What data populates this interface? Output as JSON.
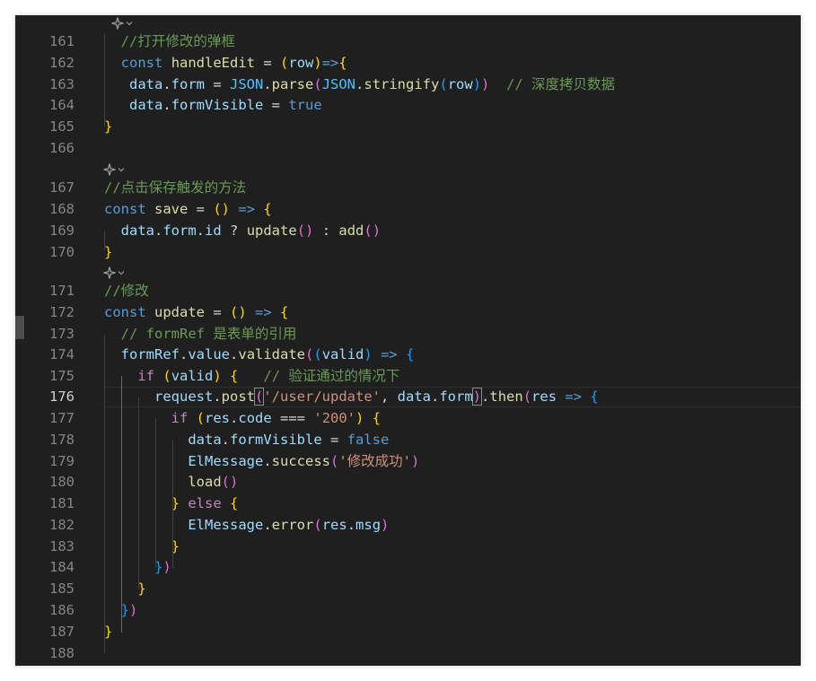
{
  "editor": {
    "language": "javascript",
    "current_line": 176,
    "codelens_icon": "codelens-sparkle-icon",
    "colors": {
      "background": "#1f1f1f",
      "line_number": "#858585",
      "keyword": "#569cd6",
      "control": "#c586c0",
      "variable": "#9cdcfe",
      "constant": "#4fc1ff",
      "function": "#dcdcaa",
      "string": "#ce9178",
      "comment": "#6a9955",
      "bracket_level_1": "#ffd700",
      "bracket_level_2": "#da70d6",
      "bracket_level_3": "#179fff"
    },
    "lines": [
      {
        "num": "161",
        "tokens": [
          {
            "t": "  ",
            "k": "p"
          },
          {
            "t": "//打开修改的弹框",
            "k": "cm"
          }
        ]
      },
      {
        "num": "162",
        "tokens": [
          {
            "t": "  ",
            "k": "p"
          },
          {
            "t": "const",
            "k": "kw"
          },
          {
            "t": " ",
            "k": "p"
          },
          {
            "t": "handleEdit",
            "k": "fn"
          },
          {
            "t": " = ",
            "k": "p"
          },
          {
            "t": "(",
            "k": "b1"
          },
          {
            "t": "row",
            "k": "v"
          },
          {
            "t": ")",
            "k": "b1"
          },
          {
            "t": "=>",
            "k": "kw"
          },
          {
            "t": "{",
            "k": "b1"
          }
        ]
      },
      {
        "num": "163",
        "tokens": [
          {
            "t": "   ",
            "k": "p"
          },
          {
            "t": "data",
            "k": "v"
          },
          {
            "t": ".",
            "k": "p"
          },
          {
            "t": "form",
            "k": "v"
          },
          {
            "t": " = ",
            "k": "p"
          },
          {
            "t": "JSON",
            "k": "c"
          },
          {
            "t": ".",
            "k": "p"
          },
          {
            "t": "parse",
            "k": "fn"
          },
          {
            "t": "(",
            "k": "b2"
          },
          {
            "t": "JSON",
            "k": "c"
          },
          {
            "t": ".",
            "k": "p"
          },
          {
            "t": "stringify",
            "k": "fn"
          },
          {
            "t": "(",
            "k": "b3"
          },
          {
            "t": "row",
            "k": "v"
          },
          {
            "t": ")",
            "k": "b3"
          },
          {
            "t": ")",
            "k": "b2"
          },
          {
            "t": "  ",
            "k": "p"
          },
          {
            "t": "// 深度拷贝数据",
            "k": "cm"
          }
        ]
      },
      {
        "num": "164",
        "tokens": [
          {
            "t": "   ",
            "k": "p"
          },
          {
            "t": "data",
            "k": "v"
          },
          {
            "t": ".",
            "k": "p"
          },
          {
            "t": "formVisible",
            "k": "v"
          },
          {
            "t": " = ",
            "k": "p"
          },
          {
            "t": "true",
            "k": "kw"
          }
        ]
      },
      {
        "num": "165",
        "tokens": [
          {
            "t": "}",
            "k": "b1"
          }
        ]
      },
      {
        "num": "166",
        "tokens": []
      },
      {
        "num": "167",
        "tokens": [
          {
            "t": "//点击保存触发的方法",
            "k": "cm"
          }
        ]
      },
      {
        "num": "168",
        "tokens": [
          {
            "t": "const",
            "k": "kw"
          },
          {
            "t": " ",
            "k": "p"
          },
          {
            "t": "save",
            "k": "fn"
          },
          {
            "t": " = ",
            "k": "p"
          },
          {
            "t": "()",
            "k": "b1"
          },
          {
            "t": " ",
            "k": "p"
          },
          {
            "t": "=>",
            "k": "kw"
          },
          {
            "t": " ",
            "k": "p"
          },
          {
            "t": "{",
            "k": "b1"
          }
        ]
      },
      {
        "num": "169",
        "tokens": [
          {
            "t": "  ",
            "k": "p"
          },
          {
            "t": "data",
            "k": "v"
          },
          {
            "t": ".",
            "k": "p"
          },
          {
            "t": "form",
            "k": "v"
          },
          {
            "t": ".",
            "k": "p"
          },
          {
            "t": "id",
            "k": "v"
          },
          {
            "t": " ? ",
            "k": "p"
          },
          {
            "t": "update",
            "k": "fn"
          },
          {
            "t": "()",
            "k": "b2"
          },
          {
            "t": " : ",
            "k": "p"
          },
          {
            "t": "add",
            "k": "fn"
          },
          {
            "t": "()",
            "k": "b2"
          }
        ]
      },
      {
        "num": "170",
        "tokens": [
          {
            "t": "}",
            "k": "b1"
          }
        ]
      },
      {
        "num": "171",
        "tokens": [
          {
            "t": "//修改",
            "k": "cm"
          }
        ]
      },
      {
        "num": "172",
        "tokens": [
          {
            "t": "const",
            "k": "kw"
          },
          {
            "t": " ",
            "k": "p"
          },
          {
            "t": "update",
            "k": "fn"
          },
          {
            "t": " = ",
            "k": "p"
          },
          {
            "t": "()",
            "k": "b1"
          },
          {
            "t": " ",
            "k": "p"
          },
          {
            "t": "=>",
            "k": "kw"
          },
          {
            "t": " ",
            "k": "p"
          },
          {
            "t": "{",
            "k": "b1"
          }
        ]
      },
      {
        "num": "173",
        "tokens": [
          {
            "t": "  ",
            "k": "p"
          },
          {
            "t": "// formRef 是表单的引用",
            "k": "cm"
          }
        ]
      },
      {
        "num": "174",
        "tokens": [
          {
            "t": "  ",
            "k": "p"
          },
          {
            "t": "formRef",
            "k": "v"
          },
          {
            "t": ".",
            "k": "p"
          },
          {
            "t": "value",
            "k": "v"
          },
          {
            "t": ".",
            "k": "p"
          },
          {
            "t": "validate",
            "k": "fn"
          },
          {
            "t": "(",
            "k": "b2"
          },
          {
            "t": "(",
            "k": "b3"
          },
          {
            "t": "valid",
            "k": "v"
          },
          {
            "t": ")",
            "k": "b3"
          },
          {
            "t": " ",
            "k": "p"
          },
          {
            "t": "=>",
            "k": "kw"
          },
          {
            "t": " ",
            "k": "p"
          },
          {
            "t": "{",
            "k": "b3"
          }
        ]
      },
      {
        "num": "175",
        "tokens": [
          {
            "t": "    ",
            "k": "p"
          },
          {
            "t": "if",
            "k": "ctl"
          },
          {
            "t": " ",
            "k": "p"
          },
          {
            "t": "(",
            "k": "b1"
          },
          {
            "t": "valid",
            "k": "v"
          },
          {
            "t": ")",
            "k": "b1"
          },
          {
            "t": " ",
            "k": "p"
          },
          {
            "t": "{",
            "k": "b1"
          },
          {
            "t": "   ",
            "k": "p"
          },
          {
            "t": "// 验证通过的情况下",
            "k": "cm"
          }
        ]
      },
      {
        "num": "176",
        "tokens": [
          {
            "t": "      ",
            "k": "p"
          },
          {
            "t": "request",
            "k": "v"
          },
          {
            "t": ".",
            "k": "p"
          },
          {
            "t": "post",
            "k": "fn"
          },
          {
            "t": "(",
            "k": "b2",
            "m": 1
          },
          {
            "t": "'/user/update'",
            "k": "s"
          },
          {
            "t": ", ",
            "k": "p"
          },
          {
            "t": "data",
            "k": "v"
          },
          {
            "t": ".",
            "k": "p"
          },
          {
            "t": "form",
            "k": "v"
          },
          {
            "t": ")",
            "k": "b2",
            "m": 1
          },
          {
            "t": ".",
            "k": "p"
          },
          {
            "t": "then",
            "k": "fn"
          },
          {
            "t": "(",
            "k": "b2"
          },
          {
            "t": "res",
            "k": "v"
          },
          {
            "t": " ",
            "k": "p"
          },
          {
            "t": "=>",
            "k": "kw"
          },
          {
            "t": " ",
            "k": "p"
          },
          {
            "t": "{",
            "k": "b3"
          }
        ]
      },
      {
        "num": "177",
        "tokens": [
          {
            "t": "        ",
            "k": "p"
          },
          {
            "t": "if",
            "k": "ctl"
          },
          {
            "t": " ",
            "k": "p"
          },
          {
            "t": "(",
            "k": "b1"
          },
          {
            "t": "res",
            "k": "v"
          },
          {
            "t": ".",
            "k": "p"
          },
          {
            "t": "code",
            "k": "v"
          },
          {
            "t": " === ",
            "k": "p"
          },
          {
            "t": "'200'",
            "k": "s"
          },
          {
            "t": ")",
            "k": "b1"
          },
          {
            "t": " ",
            "k": "p"
          },
          {
            "t": "{",
            "k": "b1"
          }
        ]
      },
      {
        "num": "178",
        "tokens": [
          {
            "t": "          ",
            "k": "p"
          },
          {
            "t": "data",
            "k": "v"
          },
          {
            "t": ".",
            "k": "p"
          },
          {
            "t": "formVisible",
            "k": "v"
          },
          {
            "t": " = ",
            "k": "p"
          },
          {
            "t": "false",
            "k": "kw"
          }
        ]
      },
      {
        "num": "179",
        "tokens": [
          {
            "t": "          ",
            "k": "p"
          },
          {
            "t": "ElMessage",
            "k": "v"
          },
          {
            "t": ".",
            "k": "p"
          },
          {
            "t": "success",
            "k": "fn"
          },
          {
            "t": "(",
            "k": "b2"
          },
          {
            "t": "'修改成功'",
            "k": "s"
          },
          {
            "t": ")",
            "k": "b2"
          }
        ]
      },
      {
        "num": "180",
        "tokens": [
          {
            "t": "          ",
            "k": "p"
          },
          {
            "t": "load",
            "k": "fn"
          },
          {
            "t": "()",
            "k": "b2"
          }
        ]
      },
      {
        "num": "181",
        "tokens": [
          {
            "t": "        ",
            "k": "p"
          },
          {
            "t": "}",
            "k": "b1"
          },
          {
            "t": " ",
            "k": "p"
          },
          {
            "t": "else",
            "k": "ctl"
          },
          {
            "t": " ",
            "k": "p"
          },
          {
            "t": "{",
            "k": "b1"
          }
        ]
      },
      {
        "num": "182",
        "tokens": [
          {
            "t": "          ",
            "k": "p"
          },
          {
            "t": "ElMessage",
            "k": "v"
          },
          {
            "t": ".",
            "k": "p"
          },
          {
            "t": "error",
            "k": "fn"
          },
          {
            "t": "(",
            "k": "b2"
          },
          {
            "t": "res",
            "k": "v"
          },
          {
            "t": ".",
            "k": "p"
          },
          {
            "t": "msg",
            "k": "v"
          },
          {
            "t": ")",
            "k": "b2"
          }
        ]
      },
      {
        "num": "183",
        "tokens": [
          {
            "t": "        ",
            "k": "p"
          },
          {
            "t": "}",
            "k": "b1"
          }
        ]
      },
      {
        "num": "184",
        "tokens": [
          {
            "t": "      ",
            "k": "p"
          },
          {
            "t": "}",
            "k": "b3"
          },
          {
            "t": ")",
            "k": "b2"
          }
        ]
      },
      {
        "num": "185",
        "tokens": [
          {
            "t": "    ",
            "k": "p"
          },
          {
            "t": "}",
            "k": "b1"
          }
        ]
      },
      {
        "num": "186",
        "tokens": [
          {
            "t": "  ",
            "k": "p"
          },
          {
            "t": "}",
            "k": "b3"
          },
          {
            "t": ")",
            "k": "b2"
          }
        ]
      },
      {
        "num": "187",
        "tokens": [
          {
            "t": "}",
            "k": "b1"
          }
        ]
      },
      {
        "num": "188",
        "tokens": []
      }
    ]
  }
}
